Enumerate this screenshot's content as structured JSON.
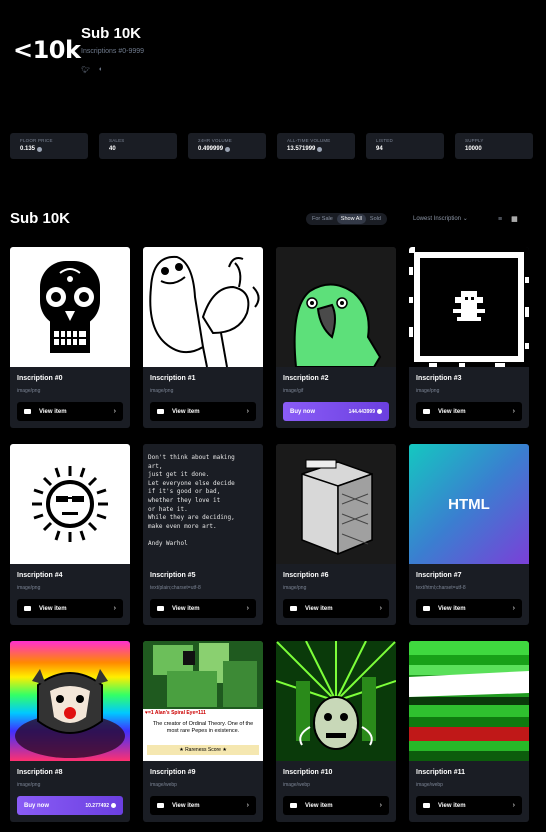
{
  "header": {
    "logo": "<10k",
    "title": "Sub 10K",
    "subtitle": "Inscriptions #0-9999",
    "socials": [
      "twitter-icon",
      "discord-icon"
    ]
  },
  "stats": [
    {
      "label": "FLOOR PRICE",
      "value": "0.135"
    },
    {
      "label": "SALES",
      "value": "40"
    },
    {
      "label": "24HR VOLUME",
      "value": "0.499999"
    },
    {
      "label": "ALL-TIME VOLUME",
      "value": "13.571999"
    },
    {
      "label": "LISTED",
      "value": "94"
    },
    {
      "label": "SUPPLY",
      "value": "10000"
    }
  ],
  "section": {
    "title": "Sub 10K",
    "filters": [
      "For Sale",
      "Show All",
      "Sold"
    ],
    "active_filter": "Show All",
    "sort_label": "Lowest Inscription",
    "sort_icon": "chevron-down-icon",
    "view_modes": [
      "list-view-icon",
      "grid-view-icon"
    ],
    "active_view": "grid-view-icon"
  },
  "buttons": {
    "view": "View item",
    "buy": "Buy now"
  },
  "items": [
    {
      "name": "Inscription #0",
      "mime": "image/png",
      "action": "view"
    },
    {
      "name": "Inscription #1",
      "mime": "image/png",
      "action": "view"
    },
    {
      "name": "Inscription #2",
      "mime": "image/gif",
      "action": "buy",
      "price": "144.443999"
    },
    {
      "name": "Inscription #3",
      "mime": "image/png",
      "action": "view"
    },
    {
      "name": "Inscription #4",
      "mime": "image/png",
      "action": "view"
    },
    {
      "name": "Inscription #5",
      "mime": "text/plain;charset=utf-8",
      "action": "view"
    },
    {
      "name": "Inscription #6",
      "mime": "image/png",
      "action": "view"
    },
    {
      "name": "Inscription #7",
      "mime": "text/html;charset=utf-8",
      "action": "view"
    },
    {
      "name": "Inscription #8",
      "mime": "image/png",
      "action": "buy",
      "price": "10.277492"
    },
    {
      "name": "Inscription #9",
      "mime": "image/webp",
      "action": "view"
    },
    {
      "name": "Inscription #10",
      "mime": "image/webp",
      "action": "view"
    },
    {
      "name": "Inscription #11",
      "mime": "image/webp",
      "action": "view"
    }
  ],
  "quote_text": "Don't think about making\nart,\njust get it done.\nLet everyone else decide\nif it's good or bad,\nwhether they love it\nor hate it.\nWhile they are deciding,\nmake even more art.\n\nAndy Warhol",
  "html_thumb_label": "HTML",
  "theory_text": {
    "banner": "♥=1 Alan's Spiral Eye=111",
    "caption": "The creator of Ordinal Theory. One of the most rare Pepes in existence.",
    "footer": "★ Rareness Score ★"
  },
  "colors": {
    "background": "#000000",
    "card": "#1a1d24",
    "buy_gradient_start": "#8a5cf6",
    "buy_gradient_end": "#6b3fe0",
    "muted_text": "#7b8494"
  }
}
